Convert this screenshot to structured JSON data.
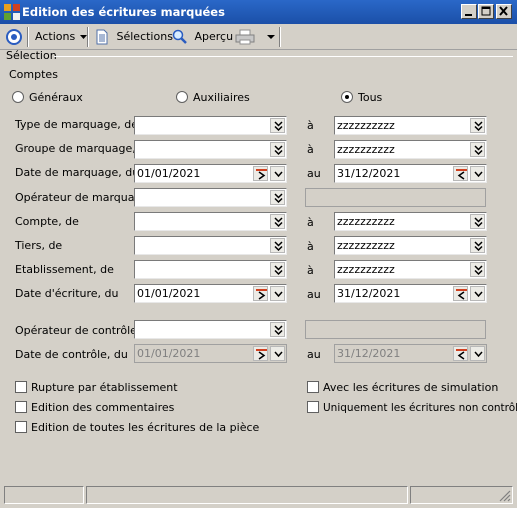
{
  "window": {
    "title": "Edition des écritures marquées"
  },
  "toolbar": {
    "actions": "Actions",
    "selections": "Sélections",
    "apercu": "Aperçu"
  },
  "section": {
    "selection": "Sélection",
    "comptes": "Comptes"
  },
  "radios": [
    {
      "label": "Généraux",
      "checked": false
    },
    {
      "label": "Auxiliaires",
      "checked": false
    },
    {
      "label": "Tous",
      "checked": true
    }
  ],
  "rows": {
    "type_marquage": {
      "label": "Type de marquage, de",
      "sep": "à",
      "from": "",
      "to": "zzzzzzzzzz"
    },
    "groupe_marquage": {
      "label": "Groupe de marquage,de",
      "sep": "à",
      "from": "",
      "to": "zzzzzzzzzz"
    },
    "date_marquage": {
      "label": "Date de marquage, du",
      "sep": "au",
      "from": "01/01/2021",
      "to": "31/12/2021"
    },
    "operateur_marquage": {
      "label": "Opérateur de marquage",
      "from": "",
      "to": ""
    },
    "compte": {
      "label": "Compte, de",
      "sep": "à",
      "from": "",
      "to": "zzzzzzzzzz"
    },
    "tiers": {
      "label": "Tiers, de",
      "sep": "à",
      "from": "",
      "to": "zzzzzzzzzz"
    },
    "etablissement": {
      "label": "Etablissement, de",
      "sep": "à",
      "from": "",
      "to": "zzzzzzzzzz"
    },
    "date_ecriture": {
      "label": "Date d'écriture, du",
      "sep": "au",
      "from": "01/01/2021",
      "to": "31/12/2021"
    },
    "operateur_controle": {
      "label": "Opérateur de contrôle",
      "from": "",
      "to": ""
    },
    "date_controle": {
      "label": "Date de contrôle, du",
      "sep": "au",
      "from": "01/01/2021",
      "to": "31/12/2021"
    }
  },
  "checkboxes": {
    "rupture": {
      "label": "Rupture par établissement",
      "checked": false
    },
    "commentaires": {
      "label": "Edition des commentaires",
      "checked": false
    },
    "toutes_ecritures": {
      "label": "Edition de toutes les écritures de la pièce",
      "checked": false
    },
    "simulation": {
      "label": "Avec les écritures de simulation",
      "checked": false
    },
    "non_controlees": {
      "label": "Uniquement les écritures non contrôlées",
      "checked": false
    }
  }
}
